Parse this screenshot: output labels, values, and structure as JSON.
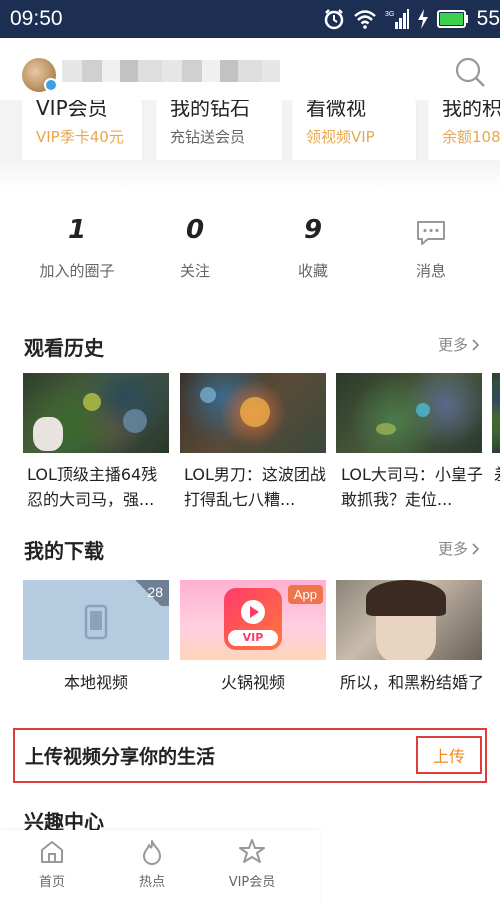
{
  "status_bar": {
    "time": "09:50",
    "signal_tag": "3G",
    "battery": "55"
  },
  "header": {
    "avatar_alt": "avatar",
    "search_icon": "search-icon"
  },
  "vip_cards": [
    {
      "title": "VIP会员",
      "subtitle": "VIP季卡40元",
      "subtitle_color": "orange"
    },
    {
      "title": "我的钻石",
      "subtitle": "充钻送会员",
      "subtitle_color": "gray"
    },
    {
      "title": "看微视",
      "subtitle": "领视频VIP",
      "subtitle_color": "orange"
    },
    {
      "title": "我的积",
      "subtitle": "余额108",
      "subtitle_color": "orange"
    }
  ],
  "stats": [
    {
      "value": "1",
      "label": "加入的圈子"
    },
    {
      "value": "0",
      "label": "关注"
    },
    {
      "value": "9",
      "label": "收藏"
    },
    {
      "value": "",
      "label": "消息",
      "icon": "message-icon"
    }
  ],
  "history": {
    "title": "观看历史",
    "more": "更多",
    "items": [
      {
        "caption": "LOL顶级主播64残忍的大司马，强..."
      },
      {
        "caption": "LOL男刀：这波团战打得乱七八糟..."
      },
      {
        "caption": "LOL大司马：小皇子敢抓我？走位..."
      },
      {
        "caption": "差"
      }
    ]
  },
  "downloads": {
    "title": "我的下载",
    "more": "更多",
    "items": [
      {
        "caption": "本地视频",
        "badge": "28"
      },
      {
        "caption": "火锅视频",
        "badge": "App",
        "logo_text": "VIP"
      },
      {
        "caption": "所以，和黑粉结婚了"
      }
    ]
  },
  "upload": {
    "text": "上传视频分享你的生活",
    "button": "上传"
  },
  "interest": {
    "title": "兴趣中心"
  },
  "bottom_nav": [
    {
      "label": "首页",
      "icon": "home-icon"
    },
    {
      "label": "热点",
      "icon": "flame-icon"
    },
    {
      "label": "VIP会员",
      "icon": "crown-star-icon"
    }
  ],
  "colors": {
    "status_bar": "#1c2f52",
    "accent_orange": "#f08a24",
    "highlight_red": "#e03c3c",
    "vip_gold": "#e8a84c"
  }
}
